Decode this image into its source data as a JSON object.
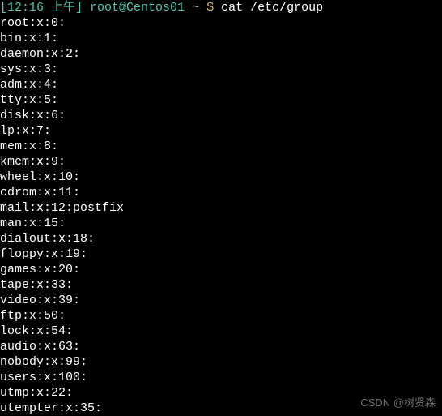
{
  "prompt": {
    "time_bracket": "[12:16 上午]",
    "user_host": "root@Centos01",
    "path": "~",
    "symbol": "$",
    "command": "cat /etc/group"
  },
  "output_lines": [
    "root:x:0:",
    "bin:x:1:",
    "daemon:x:2:",
    "sys:x:3:",
    "adm:x:4:",
    "tty:x:5:",
    "disk:x:6:",
    "lp:x:7:",
    "mem:x:8:",
    "kmem:x:9:",
    "wheel:x:10:",
    "cdrom:x:11:",
    "mail:x:12:postfix",
    "man:x:15:",
    "dialout:x:18:",
    "floppy:x:19:",
    "games:x:20:",
    "tape:x:33:",
    "video:x:39:",
    "ftp:x:50:",
    "lock:x:54:",
    "audio:x:63:",
    "nobody:x:99:",
    "users:x:100:",
    "utmp:x:22:",
    "utempter:x:35:"
  ],
  "watermark": "CSDN @树贤森"
}
